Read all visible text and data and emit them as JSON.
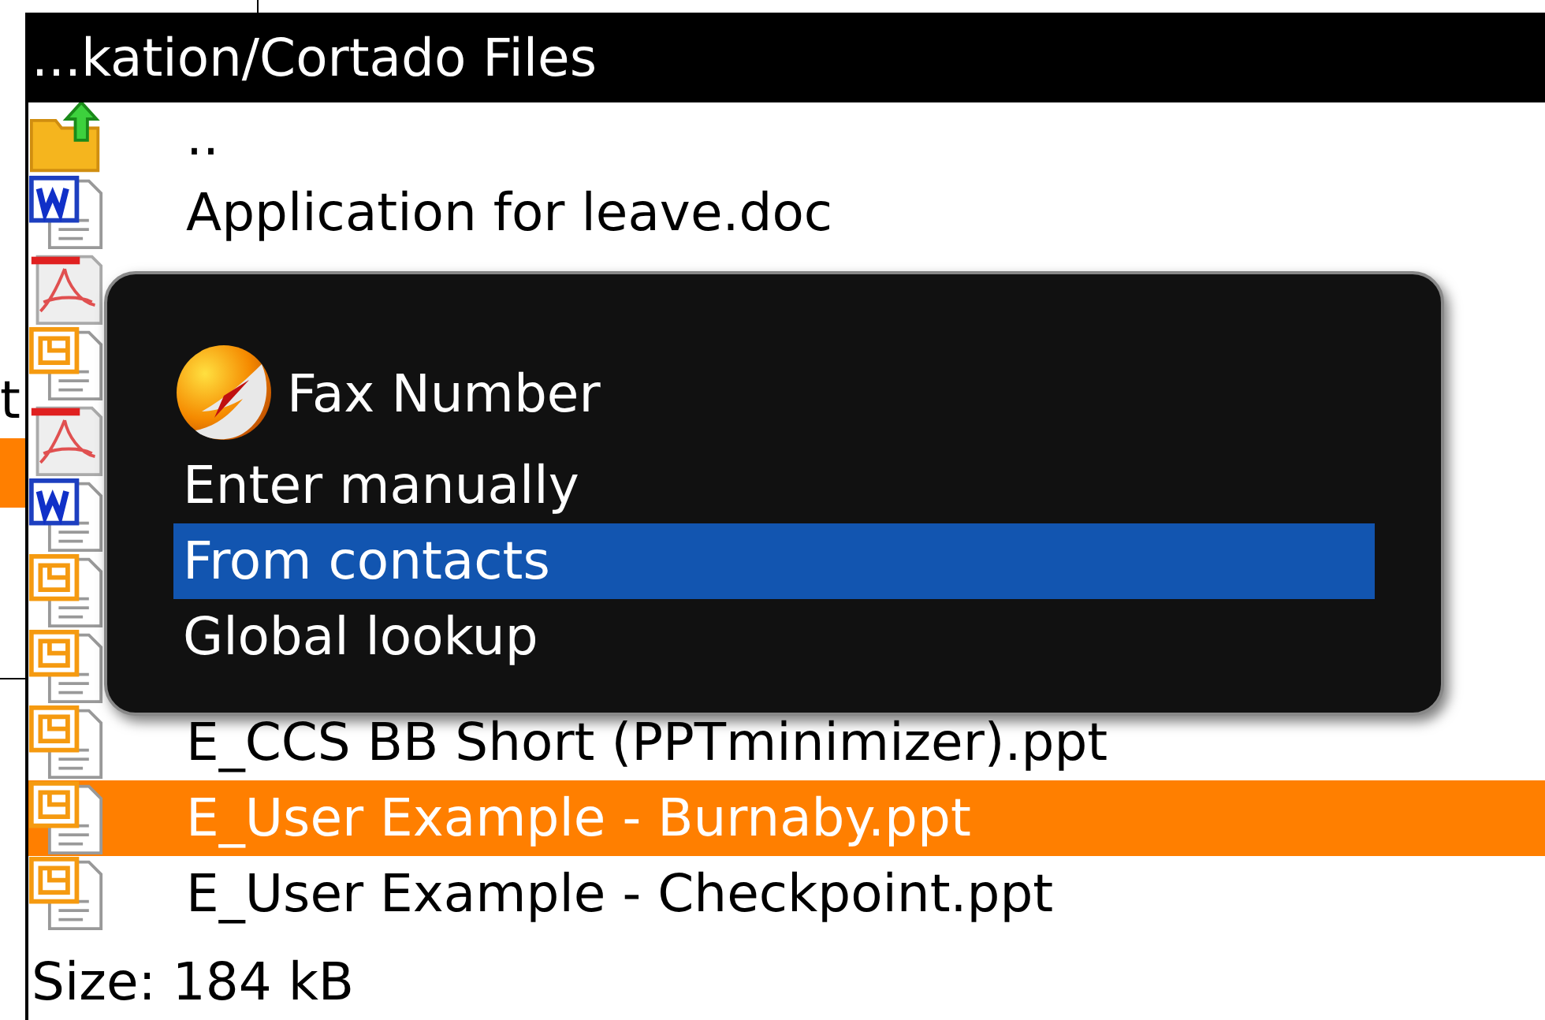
{
  "background_window": {
    "label": "t",
    "selected_bar": true
  },
  "window": {
    "title": "...kation/Cortado Files"
  },
  "files": [
    {
      "kind": "up",
      "name": "..",
      "selected": false
    },
    {
      "kind": "doc",
      "name": "Application for leave.doc",
      "selected": false
    },
    {
      "kind": "pdf",
      "selected": false
    },
    {
      "kind": "ppt",
      "selected": false
    },
    {
      "kind": "pdf",
      "selected": false
    },
    {
      "kind": "doc",
      "selected": false
    },
    {
      "kind": "ppt",
      "selected": false
    },
    {
      "kind": "ppt",
      "selected": false
    },
    {
      "kind": "ppt",
      "name": "E_CCS BB Short (PPTminimizer).ppt",
      "selected": false
    },
    {
      "kind": "ppt",
      "name": "E_User Example - Burnaby.ppt",
      "selected": true
    },
    {
      "kind": "ppt",
      "name": "E_User Example - Checkpoint.ppt",
      "selected": false
    }
  ],
  "status_bar": "Size: 184 kB",
  "dialog": {
    "title": "Fax Number",
    "options": [
      {
        "label": "Enter manually",
        "selected": false
      },
      {
        "label": "From contacts",
        "selected": true
      },
      {
        "label": "Global lookup",
        "selected": false
      }
    ]
  }
}
